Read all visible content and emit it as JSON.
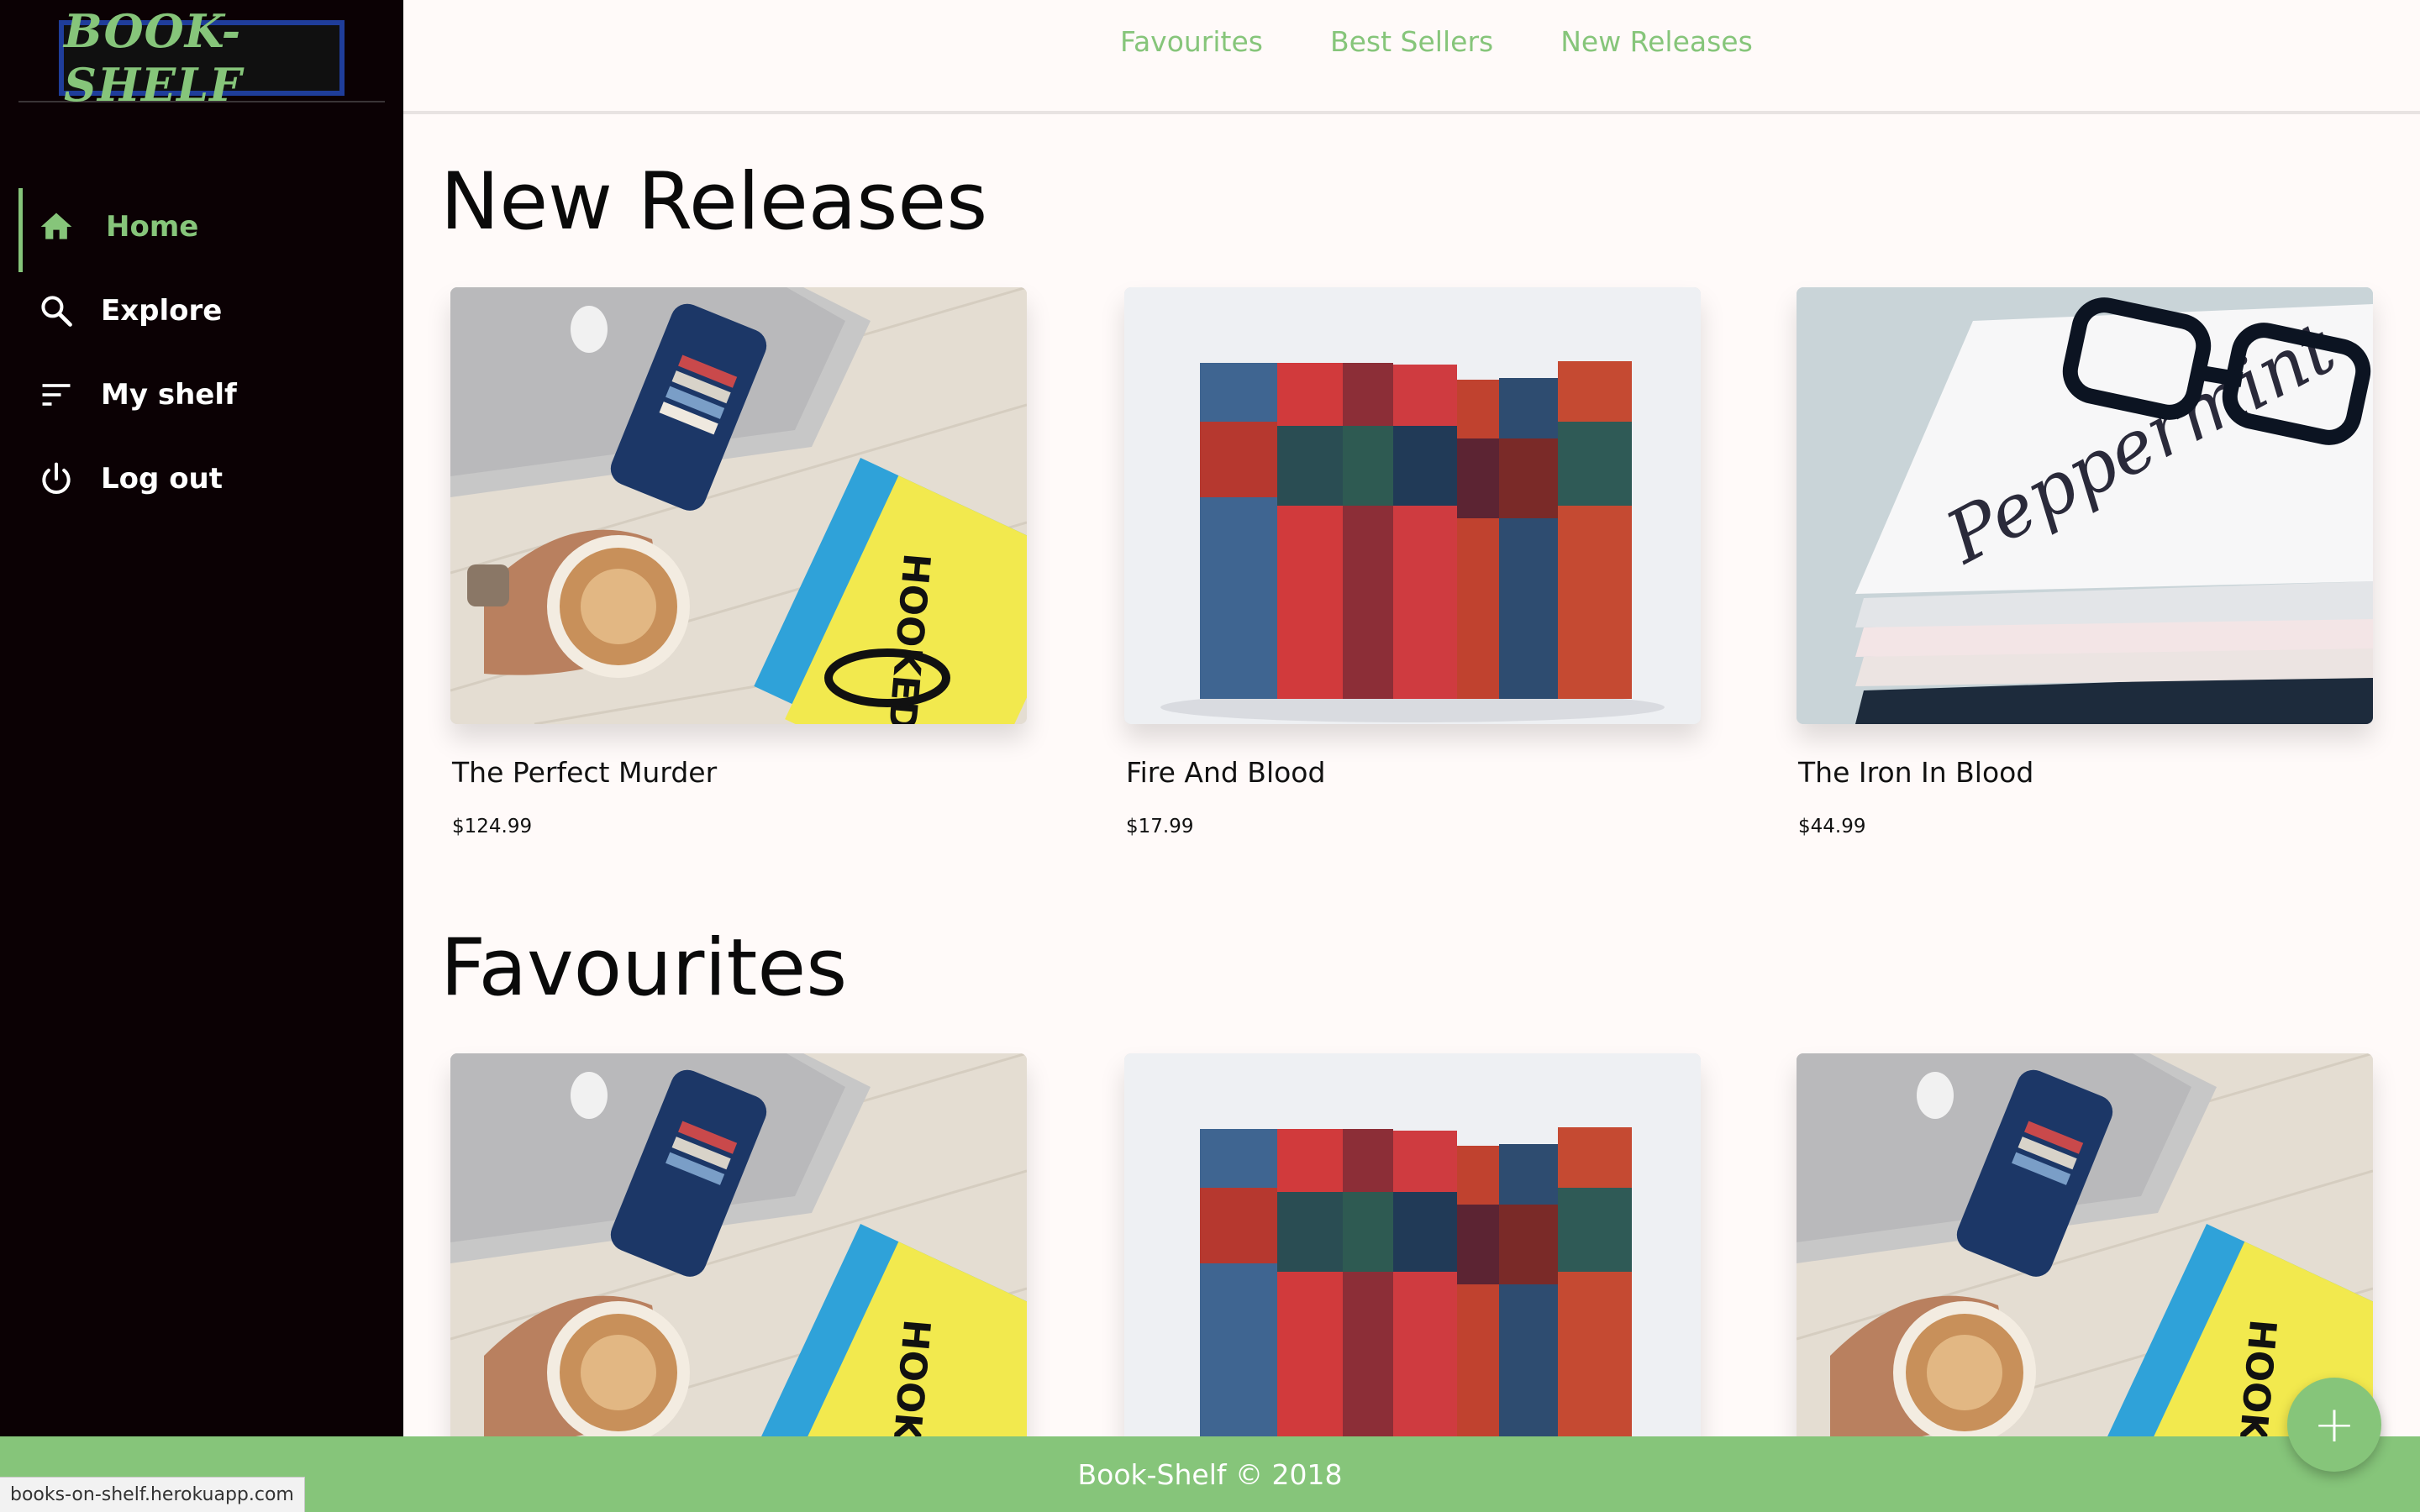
{
  "app": {
    "logo_text": "BOOK-SHELF"
  },
  "sidebar": {
    "items": [
      {
        "label": "Home",
        "icon": "home-icon",
        "active": true
      },
      {
        "label": "Explore",
        "icon": "search-icon",
        "active": false
      },
      {
        "label": "My shelf",
        "icon": "sort-lines-icon",
        "active": false
      },
      {
        "label": "Log out",
        "icon": "power-icon",
        "active": false
      }
    ]
  },
  "topnav": {
    "links": [
      "Favourites",
      "Best Sellers",
      "New Releases"
    ]
  },
  "sections": [
    {
      "title": "New Releases",
      "books": [
        {
          "title": "The Perfect Murder",
          "price": "$124.99",
          "image": "coffee-desk-photo"
        },
        {
          "title": "Fire And Blood",
          "price": "$17.99",
          "image": "book-spines-photo"
        },
        {
          "title": "The Iron In Blood",
          "price": "$44.99",
          "image": "magazines-glasses-photo"
        }
      ]
    },
    {
      "title": "Favourites",
      "books": [
        {
          "image": "coffee-desk-photo"
        },
        {
          "image": "book-spines-photo"
        },
        {
          "image": "coffee-desk-photo"
        }
      ]
    }
  ],
  "footer": {
    "text": "Book-Shelf © 2018"
  },
  "status_bar": {
    "url": "books-on-shelf.herokuapp.com"
  },
  "fab": {
    "icon": "plus-icon",
    "label": "+"
  },
  "colors": {
    "accent": "#86c57a",
    "sidebar_bg": "#0b0104",
    "page_bg": "#fffaf9"
  }
}
